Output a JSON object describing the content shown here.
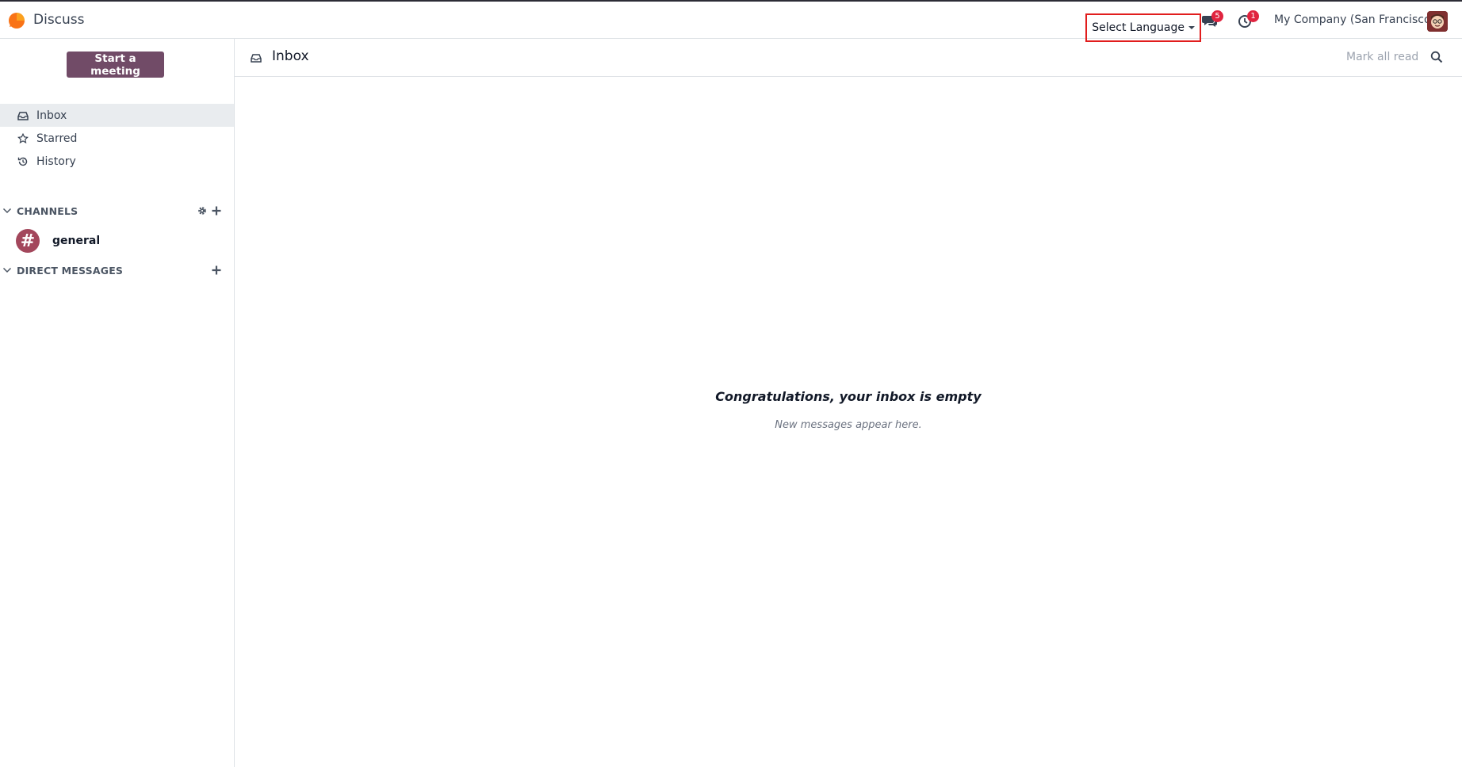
{
  "app": {
    "name": "Discuss"
  },
  "topbar": {
    "language_select": "Select Language",
    "messages_badge": "5",
    "activities_badge": "1",
    "company": "My Company (San Francisco)"
  },
  "sidebar": {
    "start_meeting": "Start a meeting",
    "items": [
      {
        "label": "Inbox",
        "icon": "inbox-icon",
        "active": true
      },
      {
        "label": "Starred",
        "icon": "star-icon",
        "active": false
      },
      {
        "label": "History",
        "icon": "history-icon",
        "active": false
      }
    ],
    "channels_header": "CHANNELS",
    "channels": [
      {
        "name": "general",
        "avatar_glyph": "#"
      }
    ],
    "dm_header": "DIRECT MESSAGES"
  },
  "main": {
    "title": "Inbox",
    "mark_all_read": "Mark all read",
    "empty_title": "Congratulations, your inbox is empty",
    "empty_subtitle": "New messages appear here."
  },
  "colors": {
    "brand": "#714b67",
    "badge": "#e0243f",
    "highlight_border": "#e11d1d",
    "channel_avatar": "#a3475c"
  }
}
